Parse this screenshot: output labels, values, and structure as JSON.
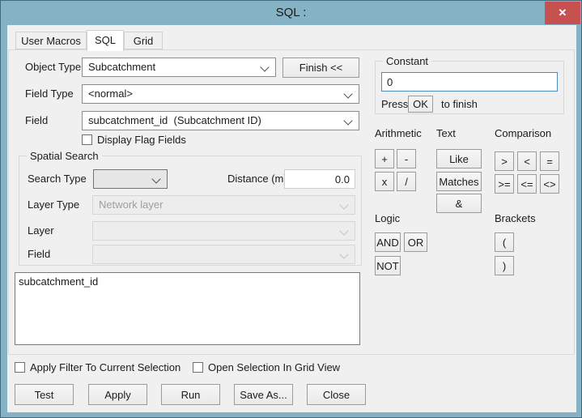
{
  "window": {
    "title": "SQL :"
  },
  "icons": {
    "close": "✕"
  },
  "colors": {
    "frame": "#85b2c4",
    "frame-border": "#3f6a7c",
    "close": "#c75050",
    "client-bg": "#f0f0f0",
    "focus-border": "#4f8abe",
    "disabled-text": "#9e9e9e"
  },
  "tabs": [
    {
      "label": "User Macros",
      "active": false
    },
    {
      "label": "SQL",
      "active": true
    },
    {
      "label": "Grid",
      "active": false
    }
  ],
  "form": {
    "object_type_label": "Object Type",
    "object_type_value": "Subcatchment",
    "finish_button": "Finish <<",
    "field_type_label": "Field Type",
    "field_type_value": "<normal>",
    "field_label": "Field",
    "field_value": "subcatchment_id  (Subcatchment ID)",
    "display_flag_checkbox": "Display Flag Fields"
  },
  "spatial": {
    "title": "Spatial Search",
    "search_type_label": "Search Type",
    "search_type_value": "",
    "distance_label": "Distance (m)",
    "distance_value": "0.0",
    "layer_type_label": "Layer Type",
    "layer_type_value": "Network layer",
    "layer_label": "Layer",
    "layer_value": "",
    "field_label": "Field",
    "field_value": ""
  },
  "sql_editor": {
    "text": "subcatchment_id"
  },
  "constant": {
    "title": "Constant",
    "value": "0",
    "press_label": "Press",
    "ok_button": "OK",
    "suffix_label": "to finish"
  },
  "ops": {
    "arithmetic": {
      "label": "Arithmetic",
      "buttons": [
        "+",
        "-",
        "x",
        "/"
      ]
    },
    "text": {
      "label": "Text",
      "buttons": [
        "Like",
        "Matches",
        "&"
      ]
    },
    "comparison": {
      "label": "Comparison",
      "buttons": [
        ">",
        "<",
        "=",
        ">=",
        "<=",
        "<>"
      ]
    },
    "logic": {
      "label": "Logic",
      "buttons": [
        "AND",
        "OR",
        "NOT"
      ]
    },
    "brackets": {
      "label": "Brackets",
      "buttons": [
        "(",
        ")"
      ]
    }
  },
  "footer": {
    "checkboxes": [
      "Apply Filter To Current Selection",
      "Open Selection In Grid View"
    ],
    "buttons": [
      "Test",
      "Apply",
      "Run",
      "Save As...",
      "Close"
    ]
  }
}
